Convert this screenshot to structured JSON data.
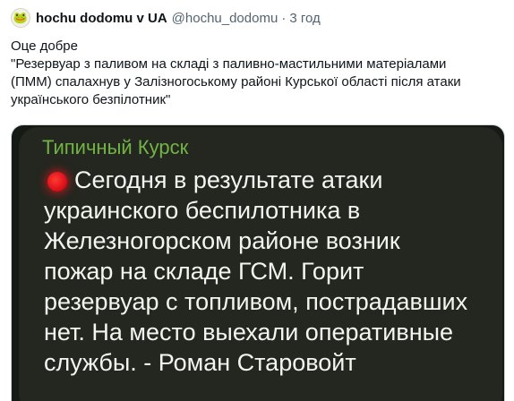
{
  "tweet": {
    "avatar_icon": "🐸",
    "display_name": "hochu dodomu v UA",
    "handle": "@hochu_dodomu",
    "separator": "·",
    "timestamp": "3 год",
    "text_lines": [
      "Оце добре",
      "\"Резервуар з паливом на складі з паливно-мастильними матеріалами",
      "(ПММ) спалахнув у Залізногоському районі Курської області після атаки",
      "українського безпілотник\""
    ]
  },
  "media": {
    "channel_name": "Типичный Курск",
    "message_lines": [
      "Сегодня в результате атаки",
      "украинского беспилотника в",
      "Железногорском районе возник",
      "пожар на складе ГСМ. Горит",
      "резервуар с топливом, пострадавших",
      "нет. На место выехали оперативные",
      "службы. - Роман Старовойт"
    ],
    "status_icon": "red-circle-icon",
    "colors": {
      "background": "#161a15",
      "bubble": "#23271f",
      "channel_name": "#72b345",
      "text": "#f4f5f0",
      "red_dot": "#e0141c"
    }
  }
}
